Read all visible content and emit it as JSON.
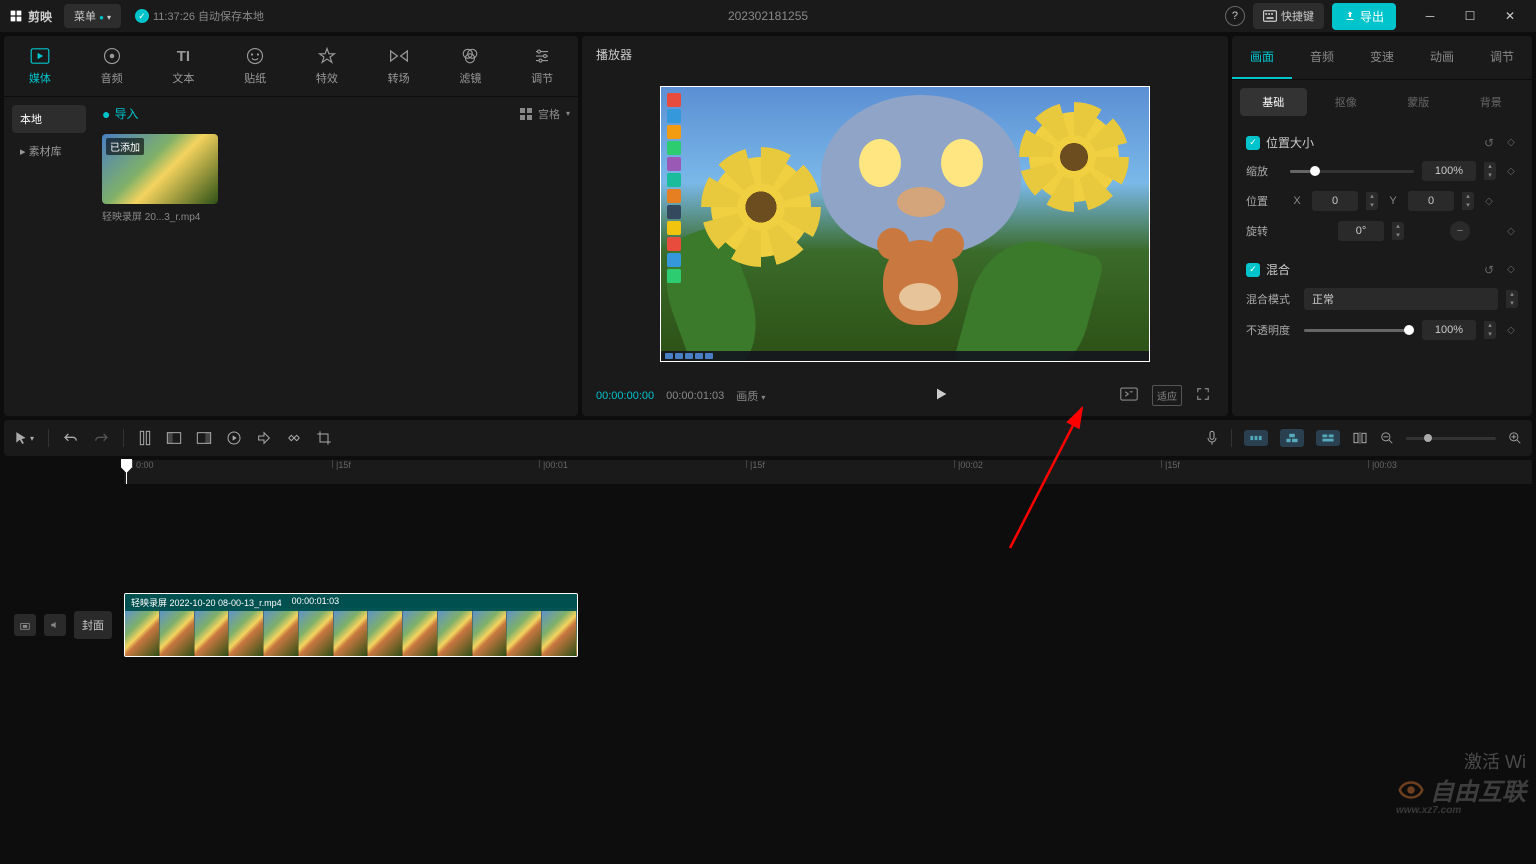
{
  "titlebar": {
    "app_name": "剪映",
    "menu": "菜单",
    "autosave": "11:37:26 自动保存本地",
    "project_name": "202302181255",
    "shortcut": "快捷键",
    "export": "导出"
  },
  "media_tabs": {
    "media": "媒体",
    "audio": "音频",
    "text": "文本",
    "sticker": "贴纸",
    "effect": "特效",
    "transition": "转场",
    "filter": "滤镜",
    "adjust": "调节"
  },
  "media_sidebar": {
    "local": "本地",
    "library": "素材库"
  },
  "media_content": {
    "import": "导入",
    "view_mode": "宫格",
    "item_badge": "已添加",
    "item_name": "轻映录屏 20...3_r.mp4"
  },
  "preview": {
    "header": "播放器",
    "time_current": "00:00:00:00",
    "time_total": "00:00:01:03",
    "quality": "画质",
    "ratio_btn": "适应"
  },
  "props_tabs": {
    "picture": "画面",
    "audio": "音频",
    "speed": "变速",
    "animation": "动画",
    "adjust": "调节"
  },
  "props_subtabs": {
    "basic": "基础",
    "cutout": "抠像",
    "mask": "蒙版",
    "background": "背景"
  },
  "transform": {
    "section": "位置大小",
    "scale": "缩放",
    "scale_value": "100%",
    "position": "位置",
    "x_label": "X",
    "x_value": "0",
    "y_label": "Y",
    "y_value": "0",
    "rotation": "旋转",
    "rotation_value": "0°"
  },
  "blend": {
    "section": "混合",
    "mode": "混合模式",
    "mode_value": "正常",
    "opacity": "不透明度",
    "opacity_value": "100%"
  },
  "timeline": {
    "cover": "封面",
    "clip_name": "轻映录屏 2022-10-20 08-00-13_r.mp4",
    "clip_duration": "00:00:01:03",
    "marks": [
      "0:00",
      "|15f",
      "|00:01",
      "|15f",
      "|00:02",
      "|15f",
      "|00:03"
    ]
  },
  "footer": {
    "activate": "激活 Wi",
    "watermark": "自由互联",
    "watermark_url": "www.xz7.com"
  }
}
